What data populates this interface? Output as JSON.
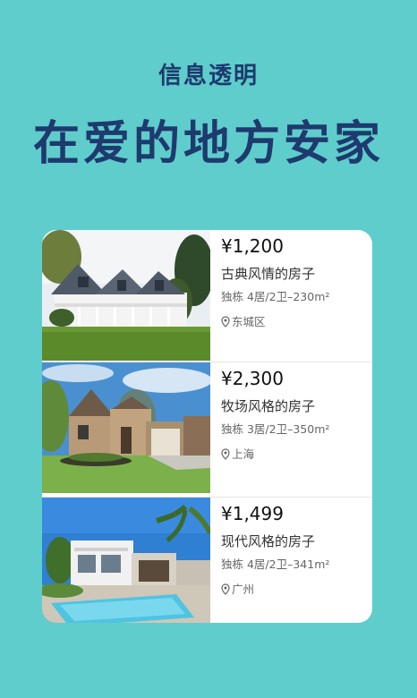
{
  "header": {
    "subtitle": "信息透明",
    "title": "在爱的地方安家"
  },
  "listings": [
    {
      "price": "¥1,200",
      "name": "古典风情的房子",
      "spec": "独栋 4居/2卫–230m²",
      "location": "东城区",
      "photo": "classic-white-house"
    },
    {
      "price": "¥2,300",
      "name": "牧场风格的房子",
      "spec": "独栋 3居/2卫–350m²",
      "location": "上海",
      "photo": "stone-ranch-house"
    },
    {
      "price": "¥1,499",
      "name": "现代风格的房子",
      "spec": "独栋 4居/2卫–341m²",
      "location": "广州",
      "photo": "modern-pool-house"
    }
  ],
  "colors": {
    "background": "#5fcdcb",
    "heading": "#1e3a6e",
    "card": "#ffffff"
  }
}
